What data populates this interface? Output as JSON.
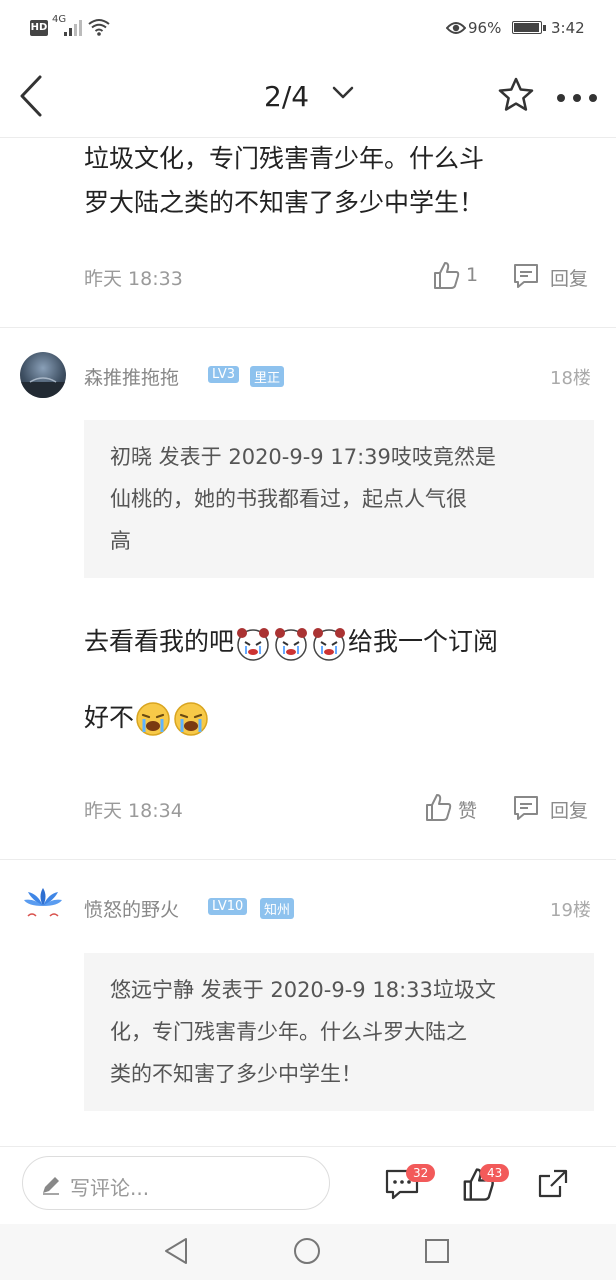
{
  "status_bar": {
    "hd": "HD",
    "signal": "4G",
    "battery": "96%",
    "battery_level": 0.96,
    "time": "3:42"
  },
  "nav": {
    "page_indicator": "2/4"
  },
  "post_top": {
    "content_line1": "垃圾文化，专门残害青少年。什么斗",
    "content_line2": "罗大陆之类的不知害了多少中学生！",
    "time": "昨天 18:33",
    "like_count": "1",
    "reply_label": "回复"
  },
  "post_18": {
    "username": "森推推拖拖",
    "level": "LV3",
    "region": "里正",
    "floor": "18楼",
    "quote_line1": "初晓 发表于 2020-9-9 17:39吱吱竟然是",
    "quote_line2": "仙桃的，她的书我都看过，起点人气很",
    "quote_line3": "高",
    "content_part1": "去看看我的吧",
    "content_part2": "给我一个订阅",
    "content_line2": "好不",
    "time": "昨天 18:34",
    "like_label": "赞",
    "reply_label": "回复"
  },
  "post_19": {
    "username": "愤怒的野火",
    "level": "LV10",
    "region": "知州",
    "floor": "19楼",
    "quote_line1": "悠远宁静 发表于 2020-9-9 18:33垃圾文",
    "quote_line2": "化，专门残害青少年。什么斗罗大陆之",
    "quote_line3": "类的不知害了多少中学生！"
  },
  "bottom_bar": {
    "comment_placeholder": "写评论...",
    "comment_count": "32",
    "like_count": "43"
  },
  "colors": {
    "badge_blue": "#8ec2ee",
    "count_red": "#f25a5a",
    "quote_bg": "#f5f5f5"
  }
}
